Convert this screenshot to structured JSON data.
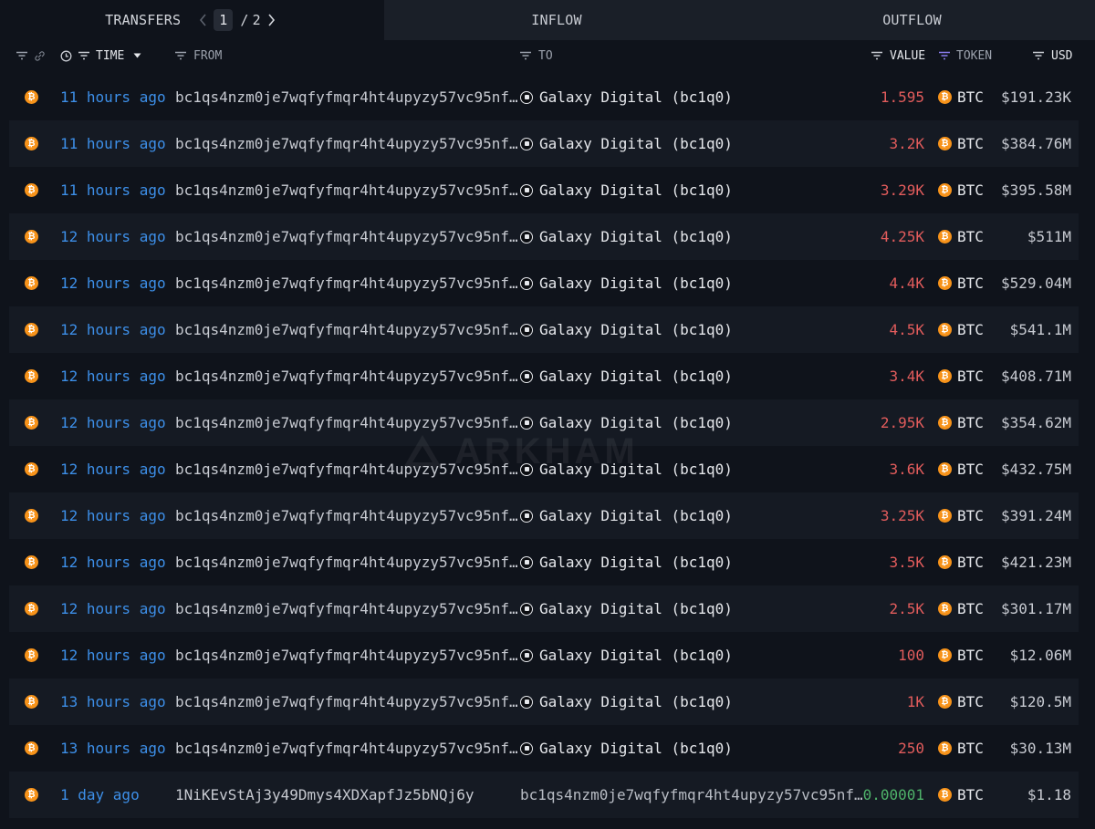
{
  "tabs": {
    "transfers": "TRANSFERS",
    "inflow": "INFLOW",
    "outflow": "OUTFLOW",
    "page_current": "1",
    "page_sep": "/",
    "page_total": "2"
  },
  "columns": {
    "time": "TIME",
    "from": "FROM",
    "to": "TO",
    "value": "VALUE",
    "token": "TOKEN",
    "usd": "USD"
  },
  "colors": {
    "outflow_value": "#e25c5c",
    "inflow_value": "#4fb36a",
    "time_link": "#3d8fe8",
    "btc": "#f7931a"
  },
  "watermark": "ARKHAM",
  "rows": [
    {
      "time": "11 hours ago",
      "from": "bc1qs4nzm0je7wqfyfmqr4ht4upyzy57vc95nf…",
      "to": "Galaxy Digital (bc1q0)",
      "value": "1.595",
      "token": "BTC",
      "usd": "$191.23K",
      "direction": "out"
    },
    {
      "time": "11 hours ago",
      "from": "bc1qs4nzm0je7wqfyfmqr4ht4upyzy57vc95nf…",
      "to": "Galaxy Digital (bc1q0)",
      "value": "3.2K",
      "token": "BTC",
      "usd": "$384.76M",
      "direction": "out"
    },
    {
      "time": "11 hours ago",
      "from": "bc1qs4nzm0je7wqfyfmqr4ht4upyzy57vc95nf…",
      "to": "Galaxy Digital (bc1q0)",
      "value": "3.29K",
      "token": "BTC",
      "usd": "$395.58M",
      "direction": "out"
    },
    {
      "time": "12 hours ago",
      "from": "bc1qs4nzm0je7wqfyfmqr4ht4upyzy57vc95nf…",
      "to": "Galaxy Digital (bc1q0)",
      "value": "4.25K",
      "token": "BTC",
      "usd": "$511M",
      "direction": "out"
    },
    {
      "time": "12 hours ago",
      "from": "bc1qs4nzm0je7wqfyfmqr4ht4upyzy57vc95nf…",
      "to": "Galaxy Digital (bc1q0)",
      "value": "4.4K",
      "token": "BTC",
      "usd": "$529.04M",
      "direction": "out"
    },
    {
      "time": "12 hours ago",
      "from": "bc1qs4nzm0je7wqfyfmqr4ht4upyzy57vc95nf…",
      "to": "Galaxy Digital (bc1q0)",
      "value": "4.5K",
      "token": "BTC",
      "usd": "$541.1M",
      "direction": "out"
    },
    {
      "time": "12 hours ago",
      "from": "bc1qs4nzm0je7wqfyfmqr4ht4upyzy57vc95nf…",
      "to": "Galaxy Digital (bc1q0)",
      "value": "3.4K",
      "token": "BTC",
      "usd": "$408.71M",
      "direction": "out"
    },
    {
      "time": "12 hours ago",
      "from": "bc1qs4nzm0je7wqfyfmqr4ht4upyzy57vc95nf…",
      "to": "Galaxy Digital (bc1q0)",
      "value": "2.95K",
      "token": "BTC",
      "usd": "$354.62M",
      "direction": "out"
    },
    {
      "time": "12 hours ago",
      "from": "bc1qs4nzm0je7wqfyfmqr4ht4upyzy57vc95nf…",
      "to": "Galaxy Digital (bc1q0)",
      "value": "3.6K",
      "token": "BTC",
      "usd": "$432.75M",
      "direction": "out"
    },
    {
      "time": "12 hours ago",
      "from": "bc1qs4nzm0je7wqfyfmqr4ht4upyzy57vc95nf…",
      "to": "Galaxy Digital (bc1q0)",
      "value": "3.25K",
      "token": "BTC",
      "usd": "$391.24M",
      "direction": "out"
    },
    {
      "time": "12 hours ago",
      "from": "bc1qs4nzm0je7wqfyfmqr4ht4upyzy57vc95nf…",
      "to": "Galaxy Digital (bc1q0)",
      "value": "3.5K",
      "token": "BTC",
      "usd": "$421.23M",
      "direction": "out"
    },
    {
      "time": "12 hours ago",
      "from": "bc1qs4nzm0je7wqfyfmqr4ht4upyzy57vc95nf…",
      "to": "Galaxy Digital (bc1q0)",
      "value": "2.5K",
      "token": "BTC",
      "usd": "$301.17M",
      "direction": "out"
    },
    {
      "time": "12 hours ago",
      "from": "bc1qs4nzm0je7wqfyfmqr4ht4upyzy57vc95nf…",
      "to": "Galaxy Digital (bc1q0)",
      "value": "100",
      "token": "BTC",
      "usd": "$12.06M",
      "direction": "out"
    },
    {
      "time": "13 hours ago",
      "from": "bc1qs4nzm0je7wqfyfmqr4ht4upyzy57vc95nf…",
      "to": "Galaxy Digital (bc1q0)",
      "value": "1K",
      "token": "BTC",
      "usd": "$120.5M",
      "direction": "out"
    },
    {
      "time": "13 hours ago",
      "from": "bc1qs4nzm0je7wqfyfmqr4ht4upyzy57vc95nf…",
      "to": "Galaxy Digital (bc1q0)",
      "value": "250",
      "token": "BTC",
      "usd": "$30.13M",
      "direction": "out"
    },
    {
      "time": "1 day ago",
      "from": "1NiKEvStAj3y49Dmys4XDXapfJz5bNQj6y",
      "to": "bc1qs4nzm0je7wqfyfmqr4ht4upyzy57vc95nf…",
      "value": "0.00001",
      "token": "BTC",
      "usd": "$1.18",
      "direction": "in"
    }
  ]
}
